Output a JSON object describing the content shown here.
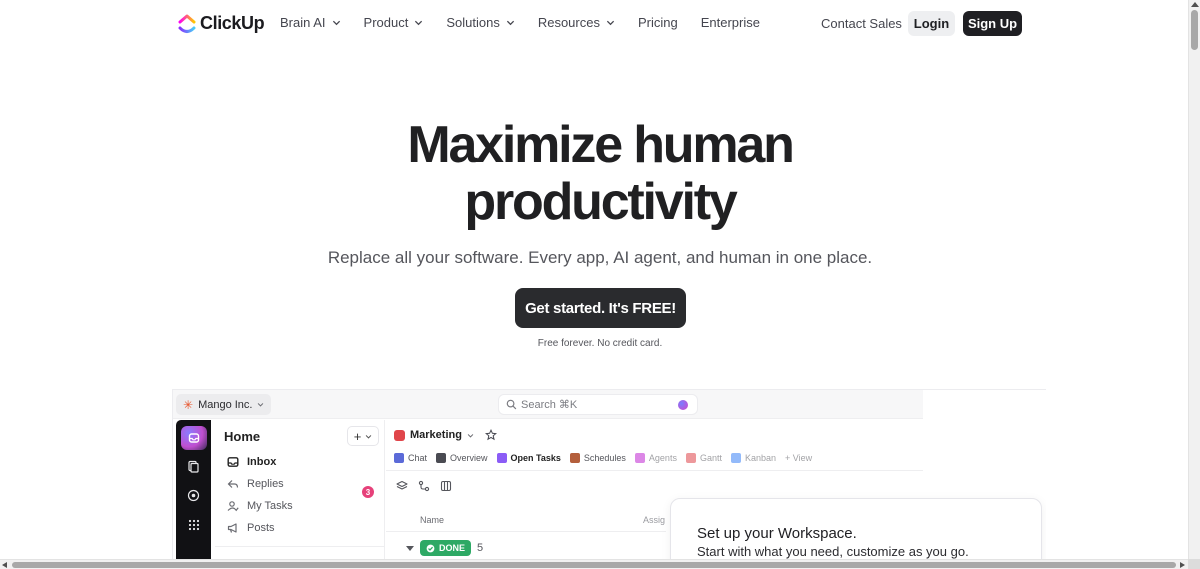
{
  "brand": {
    "name": "ClickUp"
  },
  "nav": {
    "items": [
      {
        "label": "Brain AI",
        "has_dropdown": true
      },
      {
        "label": "Product",
        "has_dropdown": true
      },
      {
        "label": "Solutions",
        "has_dropdown": true
      },
      {
        "label": "Resources",
        "has_dropdown": true
      },
      {
        "label": "Pricing",
        "has_dropdown": false
      },
      {
        "label": "Enterprise",
        "has_dropdown": false
      }
    ],
    "contact": "Contact Sales",
    "login": "Login",
    "signup": "Sign Up"
  },
  "hero": {
    "title_line1": "Maximize human",
    "title_line2": "productivity",
    "subtitle": "Replace all your software. Every app, AI agent, and human in one place.",
    "cta": "Get started. It's FREE!",
    "cta_note": "Free forever. No credit card."
  },
  "app": {
    "workspace": "Mango Inc.",
    "search_placeholder": "Search ⌘K",
    "sidebar": {
      "title": "Home",
      "items": [
        {
          "label": "Inbox",
          "icon": "inbox-icon",
          "bold": true
        },
        {
          "label": "Replies",
          "icon": "reply-icon"
        },
        {
          "label": "My Tasks",
          "icon": "user-check-icon"
        },
        {
          "label": "Posts",
          "icon": "megaphone-icon"
        }
      ],
      "inbox_count": "3"
    },
    "list": {
      "name": "Marketing",
      "tabs": [
        {
          "label": "Chat",
          "color": "#5b6ad8"
        },
        {
          "label": "Overview",
          "color": "#4a4b52"
        },
        {
          "label": "Open Tasks",
          "color": "#8b5cf6",
          "active": true
        },
        {
          "label": "Schedules",
          "color": "#b45f3c"
        },
        {
          "label": "Agents",
          "color": "#c026d3"
        },
        {
          "label": "Gantt",
          "color": "#e0454a"
        },
        {
          "label": "Kanban",
          "color": "#3b82f6"
        },
        {
          "label": "+ View",
          "color": ""
        }
      ],
      "col_name": "Name",
      "col_assignee": "Assig",
      "status_label": "DONE",
      "status_count": "5"
    },
    "card": {
      "title": "Set up your Workspace.",
      "subtitle": "Start with what you need, customize as you go."
    }
  },
  "colors": {
    "primary_dark": "#1f1f23",
    "done_green": "#2ea965",
    "badge_pink": "#e6417a"
  }
}
